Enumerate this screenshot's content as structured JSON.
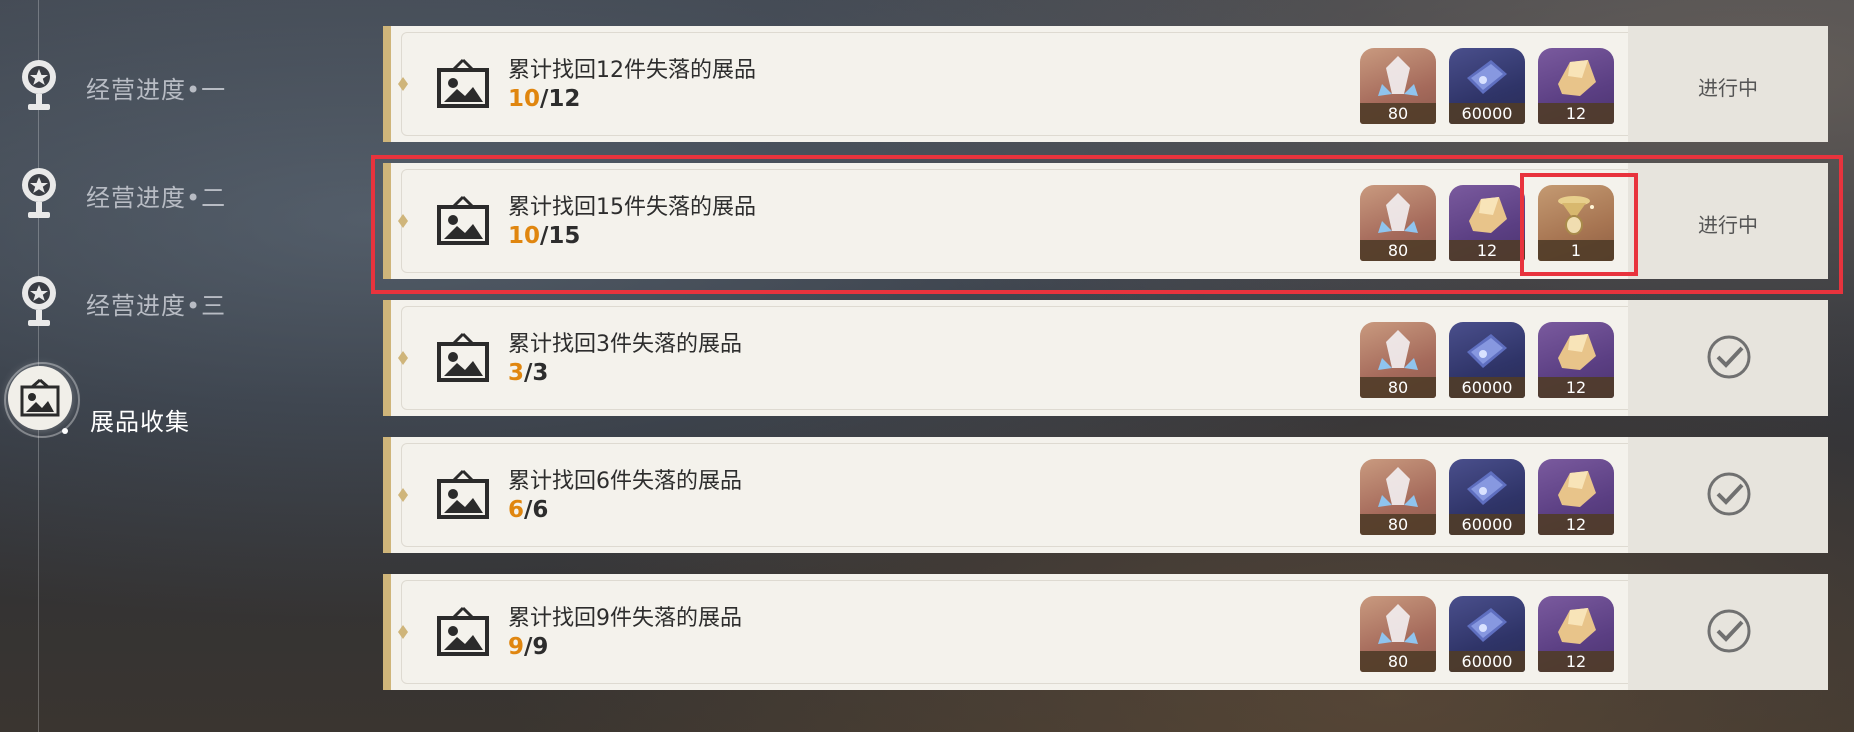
{
  "sidebar": {
    "items": [
      {
        "label": "经营进度•一"
      },
      {
        "label": "经营进度•二"
      },
      {
        "label": "经营进度•三"
      },
      {
        "label": "展品收集"
      }
    ]
  },
  "quests": [
    {
      "title": "累计找回12件失落的展品",
      "current": "10",
      "total": "/12",
      "status": "进行中",
      "rewards": [
        {
          "icon": "crystal-icon",
          "count": "80"
        },
        {
          "icon": "credit-icon",
          "count": "60000"
        },
        {
          "icon": "ore-icon",
          "count": "12"
        }
      ]
    },
    {
      "title": "累计找回15件失落的展品",
      "current": "10",
      "total": "/15",
      "status": "进行中",
      "rewards": [
        {
          "icon": "crystal-icon",
          "count": "80"
        },
        {
          "icon": "ore-icon",
          "count": "12"
        },
        {
          "icon": "relic-icon",
          "count": "1"
        }
      ]
    },
    {
      "title": "累计找回3件失落的展品",
      "current": "3",
      "total": "/3",
      "status": "completed",
      "rewards": [
        {
          "icon": "crystal-icon",
          "count": "80"
        },
        {
          "icon": "credit-icon",
          "count": "60000"
        },
        {
          "icon": "ore-icon",
          "count": "12"
        }
      ]
    },
    {
      "title": "累计找回6件失落的展品",
      "current": "6",
      "total": "/6",
      "status": "completed",
      "rewards": [
        {
          "icon": "crystal-icon",
          "count": "80"
        },
        {
          "icon": "credit-icon",
          "count": "60000"
        },
        {
          "icon": "ore-icon",
          "count": "12"
        }
      ]
    },
    {
      "title": "累计找回9件失落的展品",
      "current": "9",
      "total": "/9",
      "status": "completed",
      "rewards": [
        {
          "icon": "crystal-icon",
          "count": "80"
        },
        {
          "icon": "credit-icon",
          "count": "60000"
        },
        {
          "icon": "ore-icon",
          "count": "12"
        }
      ]
    }
  ],
  "colors": {
    "accent": "#e0860f",
    "highlight": "#e8333d",
    "row_bar": "#cfb57a"
  }
}
